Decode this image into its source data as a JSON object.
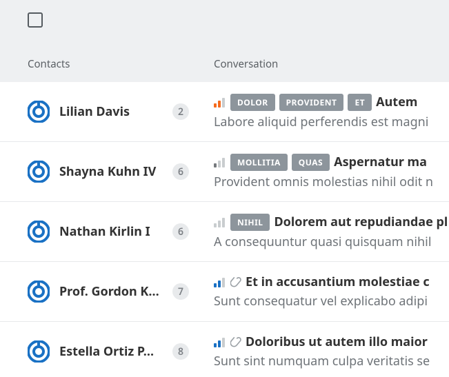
{
  "header": {
    "contacts_label": "Contacts",
    "conversation_label": "Conversation"
  },
  "priority_colors": {
    "orange": "#f56b1e",
    "grey": "#767a7e",
    "blue": "#1a71c4",
    "none": "#c9cdcf"
  },
  "rows": [
    {
      "name": "Lilian Davis",
      "count": "2",
      "priority": "orange",
      "tags": [
        "DOLOR",
        "PROVIDENT",
        "ET"
      ],
      "attachment": false,
      "subject": "Autem",
      "preview": "Labore aliquid perferendis est magni"
    },
    {
      "name": "Shayna Kuhn IV",
      "count": "6",
      "priority": "grey",
      "tags": [
        "MOLLITIA",
        "QUAS"
      ],
      "attachment": false,
      "subject": "Aspernatur ma",
      "preview": "Provident omnis molestias nihil odit n"
    },
    {
      "name": "Nathan Kirlin I",
      "count": "6",
      "priority": "none",
      "tags": [
        "NIHIL"
      ],
      "attachment": false,
      "subject": "Dolorem aut repudiandae pl",
      "preview": "A consequuntur quasi quisquam nihil"
    },
    {
      "name": "Prof. Gordon K…",
      "count": "7",
      "priority": "blue",
      "tags": [],
      "attachment": true,
      "subject": "Et in accusantium molestiae c",
      "preview": "Sunt consequatur vel explicabo adipi"
    },
    {
      "name": "Estella Ortiz P…",
      "count": "8",
      "priority": "blue",
      "tags": [],
      "attachment": true,
      "subject": "Doloribus ut autem illo maior",
      "preview": "Sunt sint numquam culpa veritatis se"
    }
  ]
}
